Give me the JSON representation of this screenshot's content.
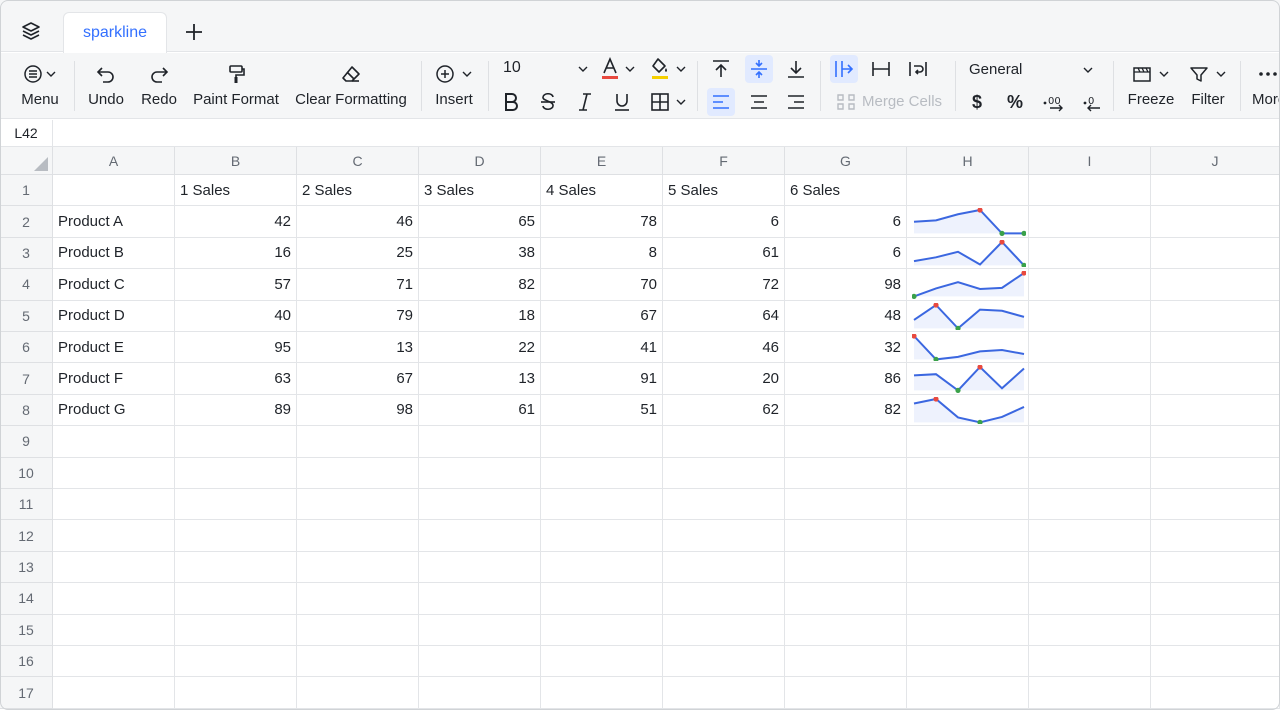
{
  "tab": {
    "name": "sparkline"
  },
  "toolbar": {
    "menu": "Menu",
    "undo": "Undo",
    "redo": "Redo",
    "paint_format": "Paint Format",
    "clear_formatting": "Clear Formatting",
    "insert": "Insert",
    "font_size": "10",
    "merge_cells": "Merge Cells",
    "number_format": "General",
    "currency": "$",
    "percent": "%",
    "freeze": "Freeze",
    "filter": "Filter",
    "more": "More"
  },
  "cell_ref": "L42",
  "columns": [
    "A",
    "B",
    "C",
    "D",
    "E",
    "F",
    "G",
    "H",
    "I",
    "J"
  ],
  "rows": [
    "1",
    "2",
    "3",
    "4",
    "5",
    "6",
    "7",
    "8",
    "9",
    "10",
    "11",
    "12",
    "13",
    "14",
    "15",
    "16",
    "17"
  ],
  "header_row": [
    "",
    "1 Sales",
    "2 Sales",
    "3 Sales",
    "4 Sales",
    "5 Sales",
    "6 Sales"
  ],
  "products": [
    {
      "name": "Product A",
      "values": [
        42,
        46,
        65,
        78,
        6,
        6
      ]
    },
    {
      "name": "Product B",
      "values": [
        16,
        25,
        38,
        8,
        61,
        6
      ]
    },
    {
      "name": "Product C",
      "values": [
        57,
        71,
        82,
        70,
        72,
        98
      ]
    },
    {
      "name": "Product D",
      "values": [
        40,
        79,
        18,
        67,
        64,
        48
      ]
    },
    {
      "name": "Product E",
      "values": [
        95,
        13,
        22,
        41,
        46,
        32
      ]
    },
    {
      "name": "Product F",
      "values": [
        63,
        67,
        13,
        91,
        20,
        86
      ]
    },
    {
      "name": "Product G",
      "values": [
        89,
        98,
        61,
        51,
        62,
        82
      ]
    }
  ],
  "colors": {
    "accent": "#3370ff",
    "spark_line": "#3b67e0",
    "spark_high": "#e8493f",
    "spark_low": "#3aa14a"
  }
}
